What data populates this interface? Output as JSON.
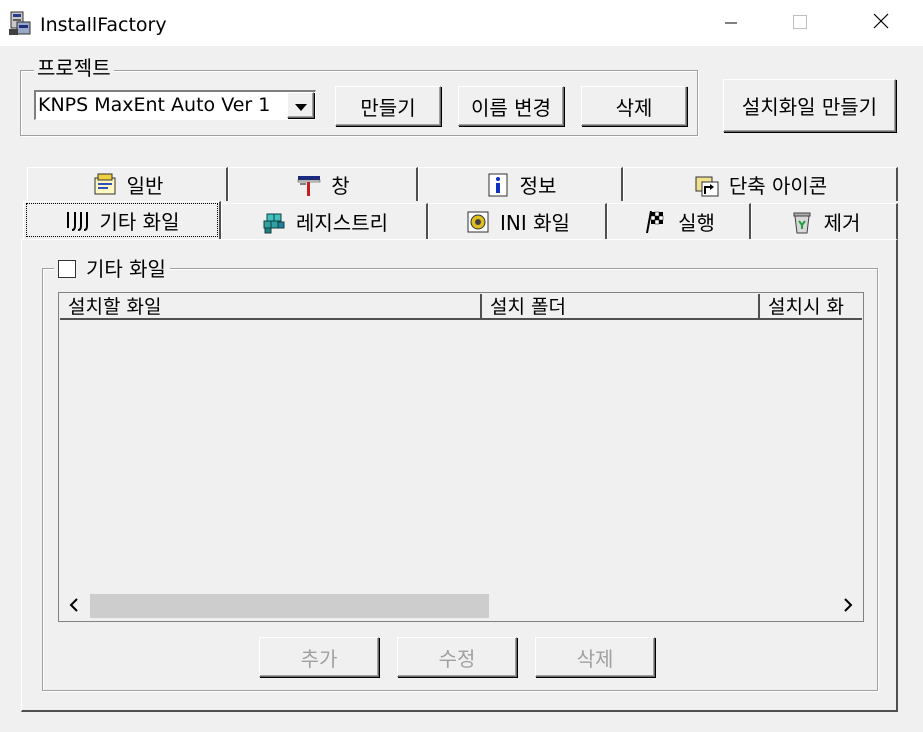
{
  "window": {
    "title": "InstallFactory"
  },
  "icons": {
    "app": "installer-icon",
    "minimize": "minimize-icon",
    "maximize": "maximize-icon",
    "close": "close-icon"
  },
  "project": {
    "legend": "프로젝트",
    "selected": "KNPS MaxEnt Auto Ver 1",
    "buttons": {
      "make": "만들기",
      "rename": "이름 변경",
      "delete": "삭제"
    }
  },
  "build_button": "설치화일 만들기",
  "tabs": {
    "row1": [
      {
        "label": "일반",
        "icon": "general-icon"
      },
      {
        "label": "창",
        "icon": "window-icon"
      },
      {
        "label": "정보",
        "icon": "info-icon"
      },
      {
        "label": "단축 아이콘",
        "icon": "shortcut-icon"
      }
    ],
    "row2": [
      {
        "label": "기타 화일",
        "icon": "other-files-icon",
        "active": true
      },
      {
        "label": "레지스트리",
        "icon": "registry-icon"
      },
      {
        "label": "INI 화일",
        "icon": "ini-file-icon"
      },
      {
        "label": "실행",
        "icon": "run-icon"
      },
      {
        "label": "제거",
        "icon": "remove-icon"
      }
    ]
  },
  "files_panel": {
    "legend": "기타 화일",
    "checked": false,
    "columns": [
      "설치할 화일",
      "설치 폴더",
      "설치시 화"
    ],
    "rows": [],
    "buttons": {
      "add": "추가",
      "edit": "수정",
      "delete": "삭제"
    }
  },
  "colors": {
    "face": "#f0f0f0",
    "shadow": "#505050",
    "disabled_text": "#a0a0a0"
  }
}
